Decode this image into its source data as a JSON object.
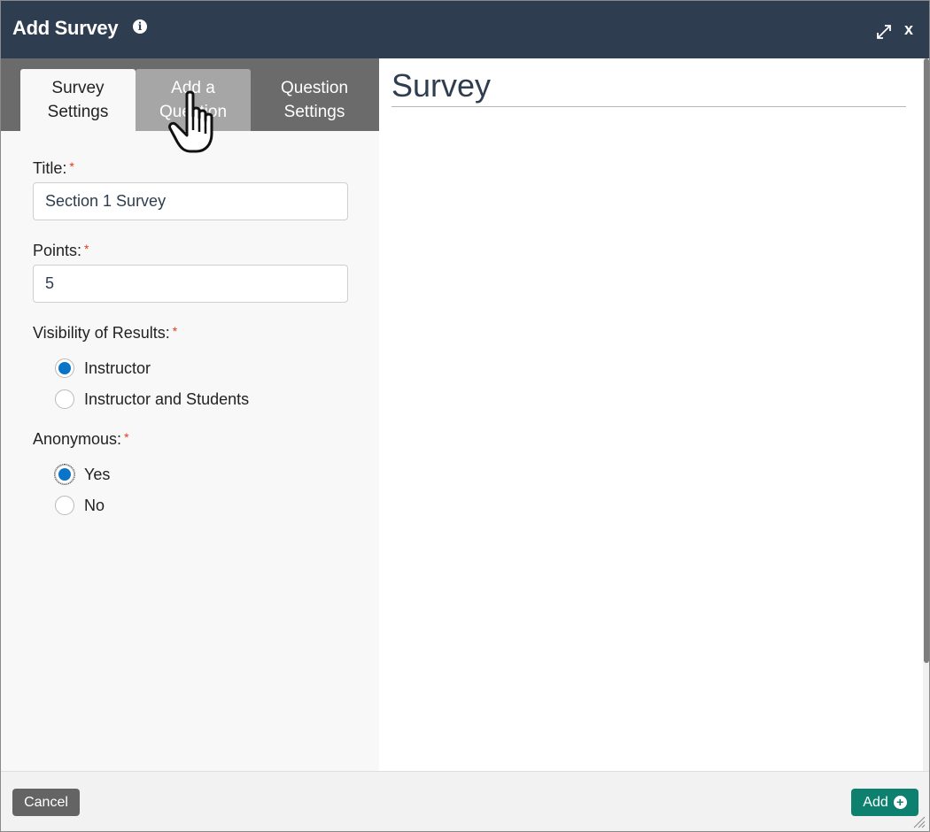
{
  "dialog": {
    "title": "Add Survey",
    "info_icon": "info-icon",
    "expand_icon": "expand-icon",
    "close_label": "x"
  },
  "tabs": [
    {
      "line1": "Survey",
      "line2": "Settings",
      "active": true
    },
    {
      "line1": "Add a",
      "line2": "Question",
      "active": false,
      "hovered": true
    },
    {
      "line1": "Question",
      "line2": "Settings",
      "active": false
    }
  ],
  "form": {
    "title_label": "Title:",
    "title_value": "Section 1 Survey",
    "points_label": "Points:",
    "points_value": "5",
    "visibility_label": "Visibility of Results:",
    "visibility_options": [
      "Instructor",
      "Instructor and Students"
    ],
    "visibility_selected": "Instructor",
    "anonymous_label": "Anonymous:",
    "anonymous_options": [
      "Yes",
      "No"
    ],
    "anonymous_selected": "Yes",
    "required_marker": "*"
  },
  "preview": {
    "heading": "Survey"
  },
  "footer": {
    "cancel_label": "Cancel",
    "add_label": "Add"
  },
  "colors": {
    "titlebar": "#2e3d4f",
    "tabbar": "#6b6b6b",
    "radio_checked": "#0a74c9",
    "add_button": "#0e8070",
    "cancel_button": "#646464",
    "required": "#e23b1a"
  }
}
